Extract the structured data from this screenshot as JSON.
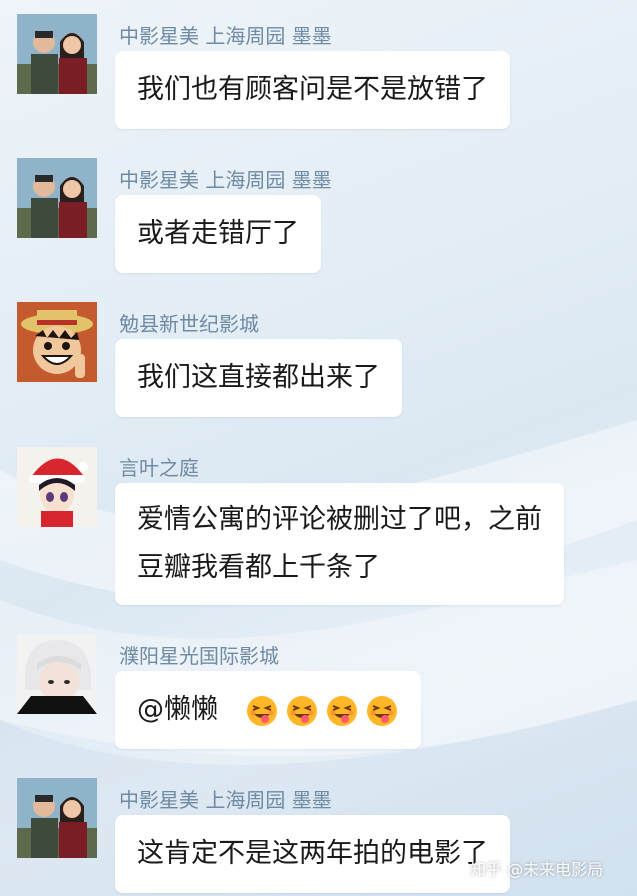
{
  "messages": [
    {
      "sender": "中影星美 上海周园 墨墨",
      "lines": [
        "我们也有顾客问是不是放错了"
      ]
    },
    {
      "sender": "中影星美 上海周园 墨墨",
      "lines": [
        "或者走错厅了"
      ]
    },
    {
      "sender": "勉县新世纪影城",
      "lines": [
        "我们这直接都出来了"
      ]
    },
    {
      "sender": "言叶之庭",
      "lines": [
        "爱情公寓的评论被删过了吧，之前",
        "豆瓣我看都上千条了"
      ]
    },
    {
      "sender": "濮阳星光国际影城",
      "lines": [
        "@懒懒"
      ],
      "emoji_count": 4
    },
    {
      "sender": "中影星美 上海周园 墨墨",
      "lines": [
        "这肯定不是这两年拍的电影了"
      ]
    }
  ],
  "watermark": "知乎 @未来电影局",
  "icons": {
    "avatar_1": "couple-photo-avatar",
    "avatar_3": "luffy-avatar",
    "avatar_4": "anime-santa-hat-avatar",
    "avatar_5": "white-hair-avatar",
    "emoji": "squinting-tongue-face-emoji"
  }
}
